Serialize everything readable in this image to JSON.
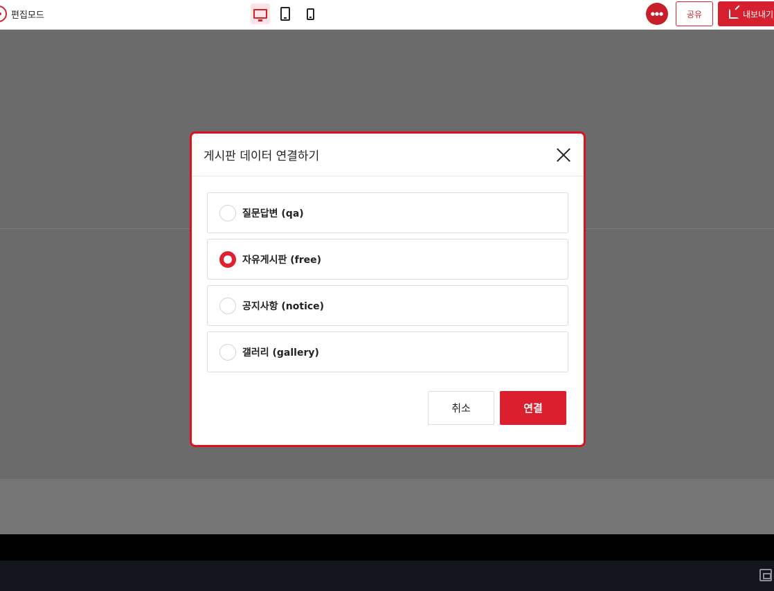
{
  "topbar": {
    "brand_label": "편집모드",
    "avatar_text": "●●●",
    "share_label": "공유",
    "export_label": "내보내기"
  },
  "devices": [
    {
      "icon": "desktop-icon",
      "active": true
    },
    {
      "icon": "tablet-icon",
      "active": false
    },
    {
      "icon": "mobile-icon",
      "active": false
    }
  ],
  "modal": {
    "title": "게시판 데이터 연결하기",
    "options": [
      {
        "label": "질문답변 (qa)",
        "selected": false
      },
      {
        "label": "자유게시판 (free)",
        "selected": true
      },
      {
        "label": "공지사항 (notice)",
        "selected": false
      },
      {
        "label": "갤러리 (gallery)",
        "selected": false
      }
    ],
    "cancel_label": "취소",
    "connect_label": "연결"
  },
  "colors": {
    "accent": "#dc1f2e",
    "overlay": "#6b6b6b"
  }
}
